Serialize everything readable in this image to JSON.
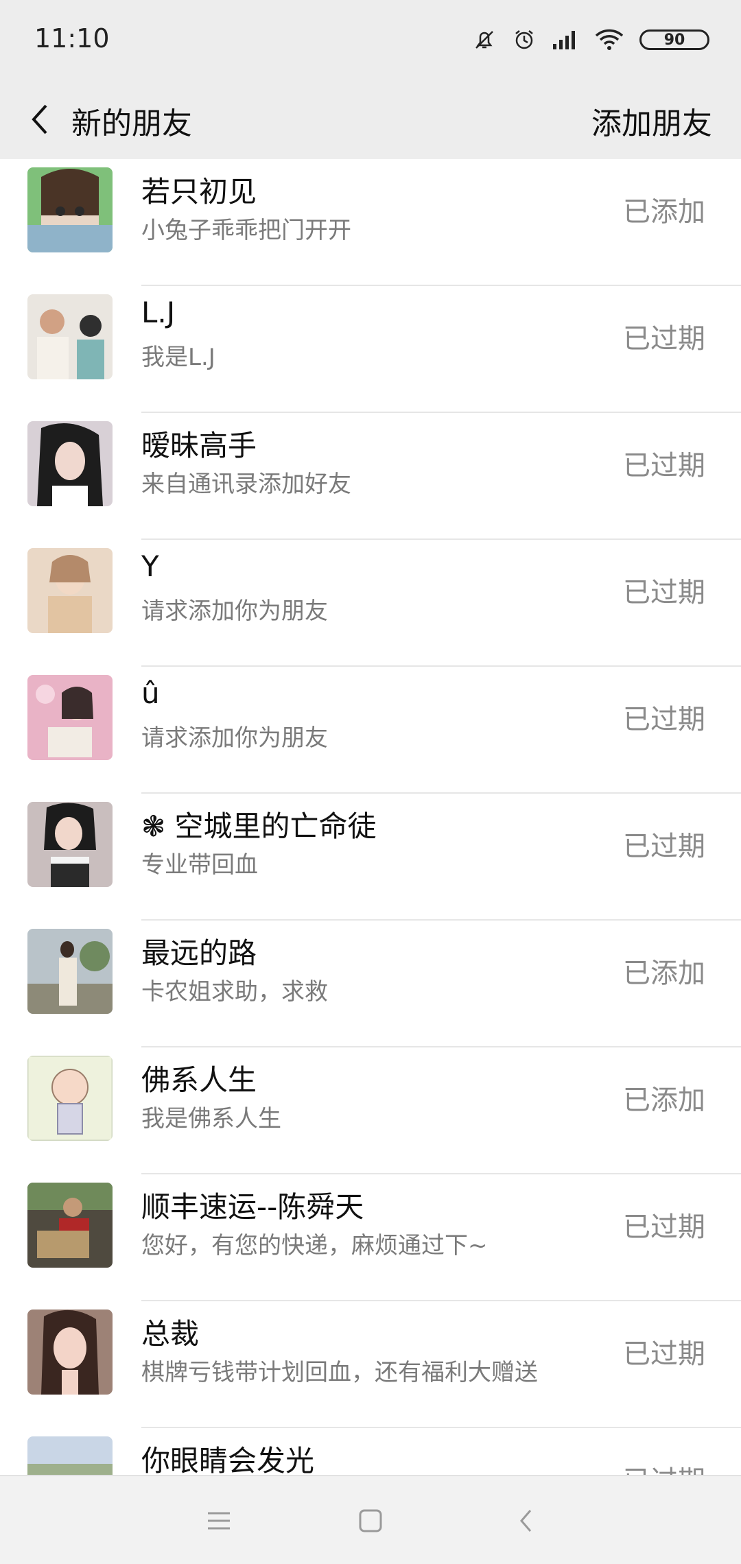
{
  "status_bar": {
    "time": "11:10",
    "battery": "90",
    "icons": [
      "mute-bell-icon",
      "alarm-icon",
      "signal-icon",
      "wifi-icon",
      "battery-icon"
    ]
  },
  "nav": {
    "title": "新的朋友",
    "action": "添加朋友",
    "back_icon": "back-arrow-icon"
  },
  "contacts": [
    {
      "name": "若只初见",
      "message": "小兔子乖乖把门开开",
      "status": "已添加",
      "avatar_color": "#8fb3c9"
    },
    {
      "name": "L.J",
      "message": "我是L.J",
      "status": "已过期",
      "avatar_color": "#c9a98a"
    },
    {
      "name": "暧昧高手",
      "message": "来自通讯录添加好友",
      "status": "已过期",
      "avatar_color": "#c8b6c2"
    },
    {
      "name": "Y",
      "message": "请求添加你为朋友",
      "status": "已过期",
      "avatar_color": "#e2c7ad"
    },
    {
      "name": "û",
      "message": "请求添加你为朋友",
      "status": "已过期",
      "avatar_color": "#d9a7b8"
    },
    {
      "name": "❃ 空城里的亡命徒",
      "message": "专业带回血",
      "status": "已过期",
      "avatar_color": "#b8a6a6"
    },
    {
      "name": "最远的路",
      "message": "卡农姐求助，求救",
      "status": "已添加",
      "avatar_color": "#a6a99a"
    },
    {
      "name": "佛系人生",
      "message": "我是佛系人生",
      "status": "已添加",
      "avatar_color": "#eef2dd"
    },
    {
      "name": "顺丰速运--陈舜天",
      "message": "您好，有您的快递，麻烦通过下~",
      "status": "已过期",
      "avatar_color": "#6f6251"
    },
    {
      "name": "总裁",
      "message": "棋牌亏钱带计划回血，还有福利大赠送",
      "status": "已过期",
      "avatar_color": "#8a6f66"
    },
    {
      "name": "你眼睛会发光",
      "message": "",
      "status": "已过期",
      "avatar_color": "#b8c7d8"
    }
  ],
  "bottom_nav": [
    "menu-icon",
    "home-icon",
    "back-icon"
  ]
}
